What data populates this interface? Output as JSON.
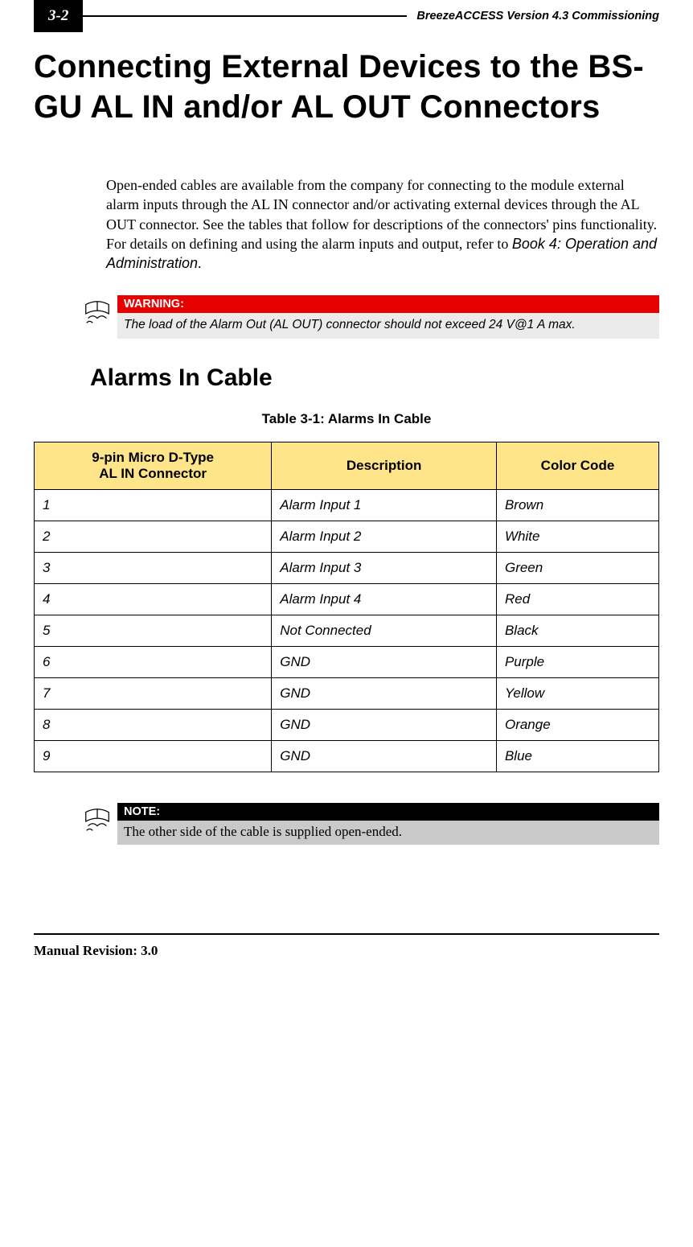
{
  "header": {
    "page_number": "3-2",
    "doc_title": "BreezeACCESS Version 4.3 Commissioning"
  },
  "title_h1": "Connecting External Devices to the BS-GU AL IN and/or AL OUT Connectors",
  "intro_paragraph": "Open-ended cables are available from the company for connecting to the module external alarm inputs through the AL IN connector and/or activating external devices through the AL OUT connector. See the tables that follow for descriptions of the connectors' pins functionality. For details on defining and using the alarm inputs and output, refer to ",
  "intro_book_ref": "Book 4: Operation and Administration",
  "intro_period": ".",
  "warning": {
    "label": "WARNING:",
    "text": "The load of the Alarm Out (AL OUT) connector should not exceed 24 V@1 A max."
  },
  "section_h2": "Alarms In Cable",
  "table": {
    "caption": "Table 3-1: Alarms In Cable",
    "head_col1_line1": "9-pin Micro D-Type",
    "head_col1_line2": "AL IN Connector",
    "head_col2": "Description",
    "head_col3": "Color Code",
    "rows": [
      {
        "pin": "1",
        "desc": "Alarm Input 1",
        "color": "Brown"
      },
      {
        "pin": "2",
        "desc": "Alarm Input 2",
        "color": "White"
      },
      {
        "pin": "3",
        "desc": "Alarm Input 3",
        "color": "Green"
      },
      {
        "pin": "4",
        "desc": "Alarm Input 4",
        "color": "Red"
      },
      {
        "pin": "5",
        "desc": "Not Connected",
        "color": "Black"
      },
      {
        "pin": "6",
        "desc": "GND",
        "color": "Purple"
      },
      {
        "pin": "7",
        "desc": "GND",
        "color": "Yellow"
      },
      {
        "pin": "8",
        "desc": "GND",
        "color": "Orange"
      },
      {
        "pin": "9",
        "desc": "GND",
        "color": "Blue"
      }
    ]
  },
  "note": {
    "label": "NOTE:",
    "text": "The other side of the cable is supplied open-ended."
  },
  "footer": "Manual Revision: 3.0"
}
